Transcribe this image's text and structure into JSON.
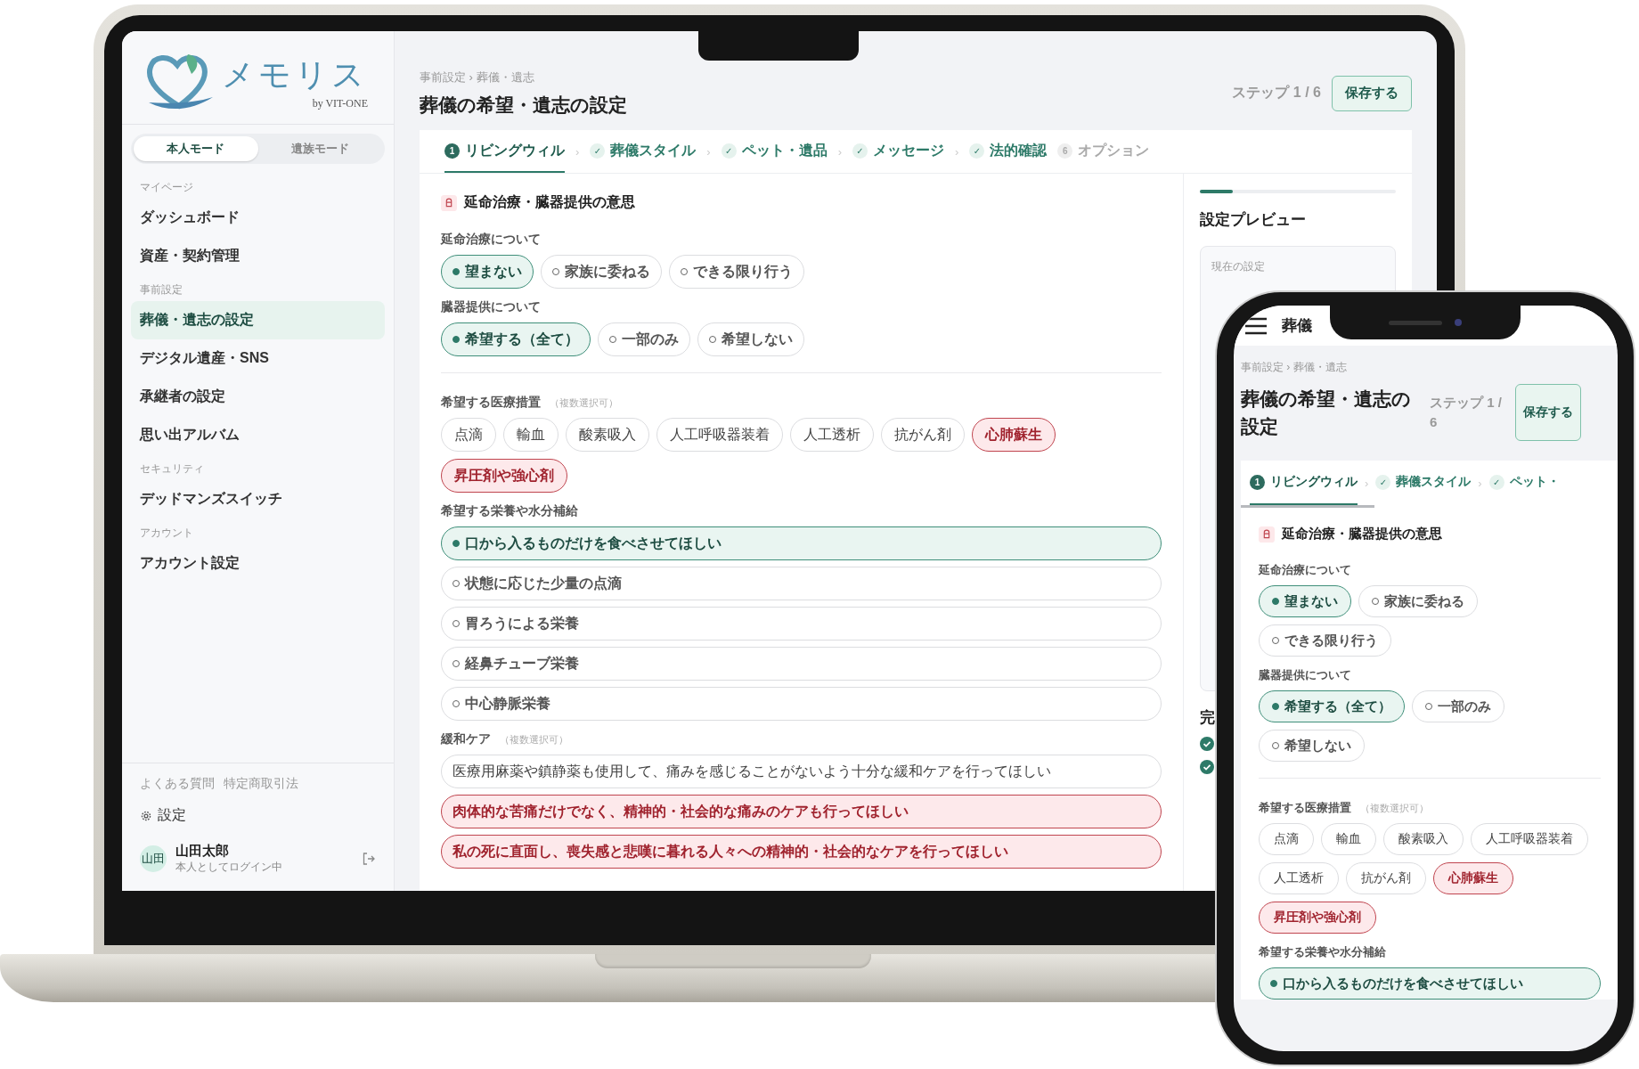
{
  "laptop": {
    "sidebar": {
      "brand": "メモリス",
      "brand_sub": "by VIT-ONE",
      "mode_tabs": [
        {
          "label": "本人モード",
          "selected": true
        },
        {
          "label": "遺族モード",
          "selected": false
        }
      ],
      "sections": [
        {
          "heading": "マイページ",
          "items": [
            {
              "label": "ダッシュボード",
              "selected": false
            },
            {
              "label": "資産・契約管理",
              "selected": false
            }
          ]
        },
        {
          "heading": "事前設定",
          "items": [
            {
              "label": "葬儀・遺志の設定",
              "selected": true
            },
            {
              "label": "デジタル遺産・SNS",
              "selected": false
            },
            {
              "label": "承継者の設定",
              "selected": false
            },
            {
              "label": "思い出アルバム",
              "selected": false
            }
          ]
        },
        {
          "heading": "セキュリティ",
          "items": [
            {
              "label": "デッドマンズスイッチ",
              "selected": false
            }
          ]
        },
        {
          "heading": "アカウント",
          "items": [
            {
              "label": "アカウント設定",
              "selected": false
            }
          ]
        }
      ],
      "footer_links": [
        "よくある質問",
        "特定商取引法"
      ],
      "settings": "設定",
      "user": {
        "avatar": "山田",
        "name": "山田太郎",
        "status": "本人としてログイン中"
      }
    },
    "breadcrumb": "事前設定 › 葬儀・遺志",
    "title": "葬儀の希望・遺志の設定",
    "step": "ステップ 1 / 6",
    "save_button": "保存する",
    "steps": [
      {
        "marker": "1",
        "label": "リビングウィル",
        "kind": "current",
        "sep": "›"
      },
      {
        "marker": "✓",
        "label": "葬儀スタイル",
        "kind": "done",
        "sep": "›"
      },
      {
        "marker": "✓",
        "label": "ペット・遺品",
        "kind": "done",
        "sep": "›"
      },
      {
        "marker": "✓",
        "label": "メッセージ",
        "kind": "done",
        "sep": "›"
      },
      {
        "marker": "✓",
        "label": "法的確認",
        "kind": "done"
      },
      {
        "marker": "6",
        "label": "オプション",
        "kind": "todo"
      }
    ],
    "form": {
      "section_title": "延命治療・臓器提供の意思",
      "groups": [
        {
          "kind": "radio",
          "label": "延命治療について",
          "options": [
            {
              "label": "望まない",
              "selected": true
            },
            {
              "label": "家族に委ねる",
              "selected": false
            },
            {
              "label": "できる限り行う",
              "selected": false
            }
          ]
        },
        {
          "kind": "radio",
          "label": "臓器提供について",
          "options": [
            {
              "label": "希望する（全て）",
              "selected": true
            },
            {
              "label": "一部のみ",
              "selected": false
            },
            {
              "label": "希望しない",
              "selected": false
            }
          ]
        },
        {
          "kind": "multi",
          "label": "希望する医療措置",
          "note": "（複数選択可）",
          "options": [
            {
              "label": "点滴",
              "selected": false
            },
            {
              "label": "輸血",
              "selected": false
            },
            {
              "label": "酸素吸入",
              "selected": false
            },
            {
              "label": "人工呼吸器装着",
              "selected": false
            },
            {
              "label": "人工透析",
              "selected": false
            },
            {
              "label": "抗がん剤",
              "selected": false
            },
            {
              "label": "心肺蘇生",
              "selected": true
            },
            {
              "label": "昇圧剤や強心剤",
              "selected": true
            }
          ]
        },
        {
          "kind": "radio-list",
          "label": "希望する栄養や水分補給",
          "options": [
            {
              "label": "口から入るものだけを食べさせてほしい",
              "selected": true
            },
            {
              "label": "状態に応じた少量の点滴",
              "selected": false
            },
            {
              "label": "胃ろうによる栄養",
              "selected": false
            },
            {
              "label": "経鼻チューブ栄養",
              "selected": false
            },
            {
              "label": "中心静脈栄養",
              "selected": false
            }
          ]
        },
        {
          "kind": "multi-list",
          "label": "緩和ケア",
          "note": "（複数選択可）",
          "options": [
            {
              "label": "医療用麻薬や鎮静薬も使用して、痛みを感じることがないよう十分な緩和ケアを行ってほしい",
              "selected": false
            },
            {
              "label": "肉体的な苦痛だけでなく、精神的・社会的な痛みのケアも行ってほしい",
              "selected": true
            },
            {
              "label": "私の死に直面し、喪失感と悲嘆に暮れる人々への精神的・社会的なケアを行ってほしい",
              "selected": true
            }
          ]
        }
      ]
    },
    "preview": {
      "level": 0.17,
      "title": "設定プレビュー",
      "current_heading": "現在の設定",
      "completed_heading": "完"
    }
  },
  "phone": {
    "header_title": "葬儀",
    "breadcrumb": "事前設定 › 葬儀・遺志",
    "title": "葬儀の希望・遺志の設定",
    "step": "ステップ 1 / 6",
    "save_button": "保存する",
    "steps": [
      {
        "marker": "1",
        "label": "リビングウィル",
        "kind": "current",
        "sep": "›"
      },
      {
        "marker": "✓",
        "label": "葬儀スタイル",
        "kind": "done",
        "sep": "›"
      },
      {
        "marker": "✓",
        "label": "ペット・",
        "kind": "done"
      }
    ],
    "form": {
      "section_title": "延命治療・臓器提供の意思",
      "groups": [
        {
          "kind": "radio",
          "label": "延命治療について",
          "options": [
            {
              "label": "望まない",
              "selected": true
            },
            {
              "label": "家族に委ねる",
              "selected": false
            },
            {
              "label": "できる限り行う",
              "selected": false
            }
          ]
        },
        {
          "kind": "radio",
          "label": "臓器提供について",
          "options": [
            {
              "label": "希望する（全て）",
              "selected": true
            },
            {
              "label": "一部のみ",
              "selected": false
            },
            {
              "label": "希望しない",
              "selected": false
            }
          ]
        },
        {
          "kind": "multi",
          "label": "希望する医療措置",
          "note": "（複数選択可）",
          "options": [
            {
              "label": "点滴",
              "selected": false
            },
            {
              "label": "輸血",
              "selected": false
            },
            {
              "label": "酸素吸入",
              "selected": false
            },
            {
              "label": "人工呼吸器装着",
              "selected": false
            },
            {
              "label": "人工透析",
              "selected": false
            },
            {
              "label": "抗がん剤",
              "selected": false
            },
            {
              "label": "心肺蘇生",
              "selected": true
            },
            {
              "label": "昇圧剤や強心剤",
              "selected": true
            }
          ]
        },
        {
          "kind": "radio-list",
          "label": "希望する栄養や水分補給",
          "options": [
            {
              "label": "口から入るものだけを食べさせてほしい",
              "selected": true
            }
          ]
        }
      ]
    }
  }
}
